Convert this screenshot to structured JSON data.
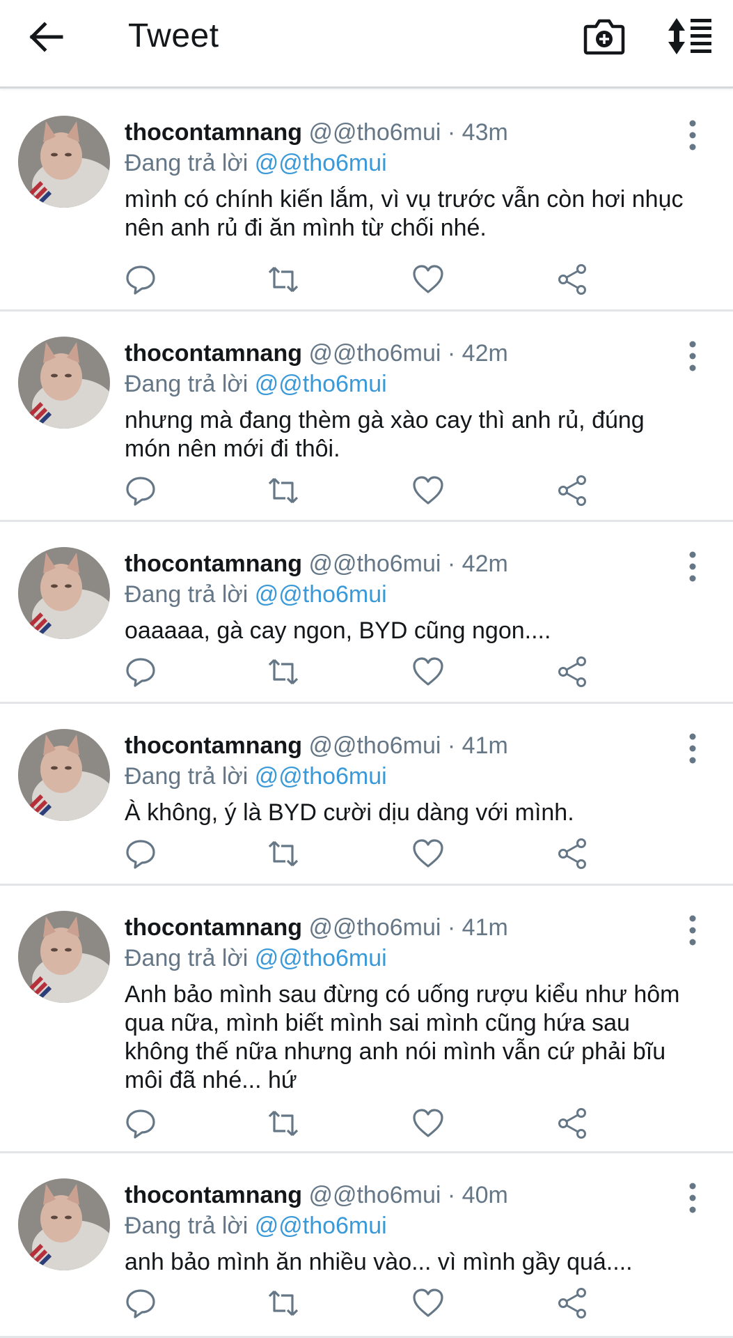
{
  "header": {
    "title": "Tweet",
    "back_icon": "arrow-left-icon",
    "camera_icon": "camera-add-icon",
    "sort_icon": "sort-list-icon"
  },
  "colors": {
    "link": "#3a9ad9",
    "secondary_text": "#657786",
    "primary_text": "#14171a",
    "divider": "#e3e5e8"
  },
  "tweets": [
    {
      "name": "thocontamnang",
      "handle": "@@tho6mui",
      "separator": "·",
      "time": "43m",
      "reply_prefix": "Đang trả lời",
      "reply_to": "@@tho6mui",
      "text": "mình có chính kiến lắm, vì vụ trước vẫn còn hơi nhục nên anh rủ đi ăn mình từ chối nhé."
    },
    {
      "name": "thocontamnang",
      "handle": "@@tho6mui",
      "separator": "·",
      "time": "42m",
      "reply_prefix": "Đang trả lời",
      "reply_to": "@@tho6mui",
      "text": "nhưng mà đang thèm gà xào cay thì anh rủ, đúng món nên mới đi thôi."
    },
    {
      "name": "thocontamnang",
      "handle": "@@tho6mui",
      "separator": "·",
      "time": "42m",
      "reply_prefix": "Đang trả lời",
      "reply_to": "@@tho6mui",
      "text": "oaaaaa, gà cay ngon, BYD cũng ngon...."
    },
    {
      "name": "thocontamnang",
      "handle": "@@tho6mui",
      "separator": "·",
      "time": "41m",
      "reply_prefix": "Đang trả lời",
      "reply_to": "@@tho6mui",
      "text": "À không, ý là BYD cười dịu dàng với mình."
    },
    {
      "name": "thocontamnang",
      "handle": "@@tho6mui",
      "separator": "·",
      "time": "41m",
      "reply_prefix": "Đang trả lời",
      "reply_to": "@@tho6mui",
      "text": "Anh bảo mình sau đừng có uống rượu kiểu như hôm qua nữa, mình biết mình sai mình cũng hứa sau không thế nữa nhưng anh nói mình vẫn cứ phải bĩu môi đã nhé... hứ"
    },
    {
      "name": "thocontamnang",
      "handle": "@@tho6mui",
      "separator": "·",
      "time": "40m",
      "reply_prefix": "Đang trả lời",
      "reply_to": "@@tho6mui",
      "text": "anh bảo mình ăn nhiều vào... vì mình gầy quá...."
    }
  ]
}
